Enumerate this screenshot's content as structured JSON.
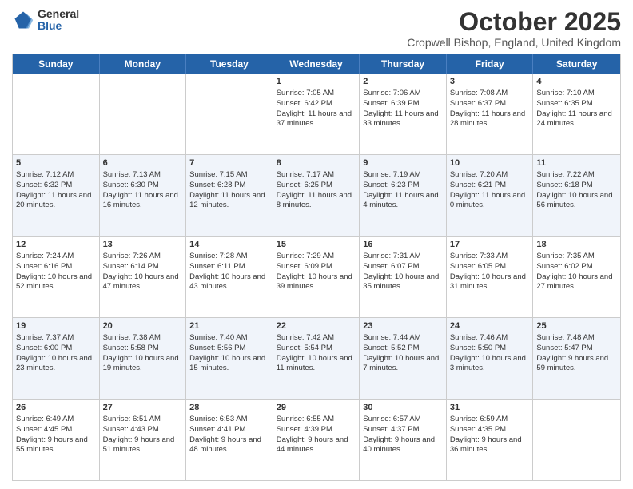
{
  "logo": {
    "general": "General",
    "blue": "Blue"
  },
  "title": "October 2025",
  "subtitle": "Cropwell Bishop, England, United Kingdom",
  "days_of_week": [
    "Sunday",
    "Monday",
    "Tuesday",
    "Wednesday",
    "Thursday",
    "Friday",
    "Saturday"
  ],
  "weeks": [
    {
      "alt": false,
      "cells": [
        {
          "day": "",
          "info": ""
        },
        {
          "day": "",
          "info": ""
        },
        {
          "day": "",
          "info": ""
        },
        {
          "day": "1",
          "info": "Sunrise: 7:05 AM\nSunset: 6:42 PM\nDaylight: 11 hours and 37 minutes."
        },
        {
          "day": "2",
          "info": "Sunrise: 7:06 AM\nSunset: 6:39 PM\nDaylight: 11 hours and 33 minutes."
        },
        {
          "day": "3",
          "info": "Sunrise: 7:08 AM\nSunset: 6:37 PM\nDaylight: 11 hours and 28 minutes."
        },
        {
          "day": "4",
          "info": "Sunrise: 7:10 AM\nSunset: 6:35 PM\nDaylight: 11 hours and 24 minutes."
        }
      ]
    },
    {
      "alt": true,
      "cells": [
        {
          "day": "5",
          "info": "Sunrise: 7:12 AM\nSunset: 6:32 PM\nDaylight: 11 hours and 20 minutes."
        },
        {
          "day": "6",
          "info": "Sunrise: 7:13 AM\nSunset: 6:30 PM\nDaylight: 11 hours and 16 minutes."
        },
        {
          "day": "7",
          "info": "Sunrise: 7:15 AM\nSunset: 6:28 PM\nDaylight: 11 hours and 12 minutes."
        },
        {
          "day": "8",
          "info": "Sunrise: 7:17 AM\nSunset: 6:25 PM\nDaylight: 11 hours and 8 minutes."
        },
        {
          "day": "9",
          "info": "Sunrise: 7:19 AM\nSunset: 6:23 PM\nDaylight: 11 hours and 4 minutes."
        },
        {
          "day": "10",
          "info": "Sunrise: 7:20 AM\nSunset: 6:21 PM\nDaylight: 11 hours and 0 minutes."
        },
        {
          "day": "11",
          "info": "Sunrise: 7:22 AM\nSunset: 6:18 PM\nDaylight: 10 hours and 56 minutes."
        }
      ]
    },
    {
      "alt": false,
      "cells": [
        {
          "day": "12",
          "info": "Sunrise: 7:24 AM\nSunset: 6:16 PM\nDaylight: 10 hours and 52 minutes."
        },
        {
          "day": "13",
          "info": "Sunrise: 7:26 AM\nSunset: 6:14 PM\nDaylight: 10 hours and 47 minutes."
        },
        {
          "day": "14",
          "info": "Sunrise: 7:28 AM\nSunset: 6:11 PM\nDaylight: 10 hours and 43 minutes."
        },
        {
          "day": "15",
          "info": "Sunrise: 7:29 AM\nSunset: 6:09 PM\nDaylight: 10 hours and 39 minutes."
        },
        {
          "day": "16",
          "info": "Sunrise: 7:31 AM\nSunset: 6:07 PM\nDaylight: 10 hours and 35 minutes."
        },
        {
          "day": "17",
          "info": "Sunrise: 7:33 AM\nSunset: 6:05 PM\nDaylight: 10 hours and 31 minutes."
        },
        {
          "day": "18",
          "info": "Sunrise: 7:35 AM\nSunset: 6:02 PM\nDaylight: 10 hours and 27 minutes."
        }
      ]
    },
    {
      "alt": true,
      "cells": [
        {
          "day": "19",
          "info": "Sunrise: 7:37 AM\nSunset: 6:00 PM\nDaylight: 10 hours and 23 minutes."
        },
        {
          "day": "20",
          "info": "Sunrise: 7:38 AM\nSunset: 5:58 PM\nDaylight: 10 hours and 19 minutes."
        },
        {
          "day": "21",
          "info": "Sunrise: 7:40 AM\nSunset: 5:56 PM\nDaylight: 10 hours and 15 minutes."
        },
        {
          "day": "22",
          "info": "Sunrise: 7:42 AM\nSunset: 5:54 PM\nDaylight: 10 hours and 11 minutes."
        },
        {
          "day": "23",
          "info": "Sunrise: 7:44 AM\nSunset: 5:52 PM\nDaylight: 10 hours and 7 minutes."
        },
        {
          "day": "24",
          "info": "Sunrise: 7:46 AM\nSunset: 5:50 PM\nDaylight: 10 hours and 3 minutes."
        },
        {
          "day": "25",
          "info": "Sunrise: 7:48 AM\nSunset: 5:47 PM\nDaylight: 9 hours and 59 minutes."
        }
      ]
    },
    {
      "alt": false,
      "cells": [
        {
          "day": "26",
          "info": "Sunrise: 6:49 AM\nSunset: 4:45 PM\nDaylight: 9 hours and 55 minutes."
        },
        {
          "day": "27",
          "info": "Sunrise: 6:51 AM\nSunset: 4:43 PM\nDaylight: 9 hours and 51 minutes."
        },
        {
          "day": "28",
          "info": "Sunrise: 6:53 AM\nSunset: 4:41 PM\nDaylight: 9 hours and 48 minutes."
        },
        {
          "day": "29",
          "info": "Sunrise: 6:55 AM\nSunset: 4:39 PM\nDaylight: 9 hours and 44 minutes."
        },
        {
          "day": "30",
          "info": "Sunrise: 6:57 AM\nSunset: 4:37 PM\nDaylight: 9 hours and 40 minutes."
        },
        {
          "day": "31",
          "info": "Sunrise: 6:59 AM\nSunset: 4:35 PM\nDaylight: 9 hours and 36 minutes."
        },
        {
          "day": "",
          "info": ""
        }
      ]
    }
  ]
}
